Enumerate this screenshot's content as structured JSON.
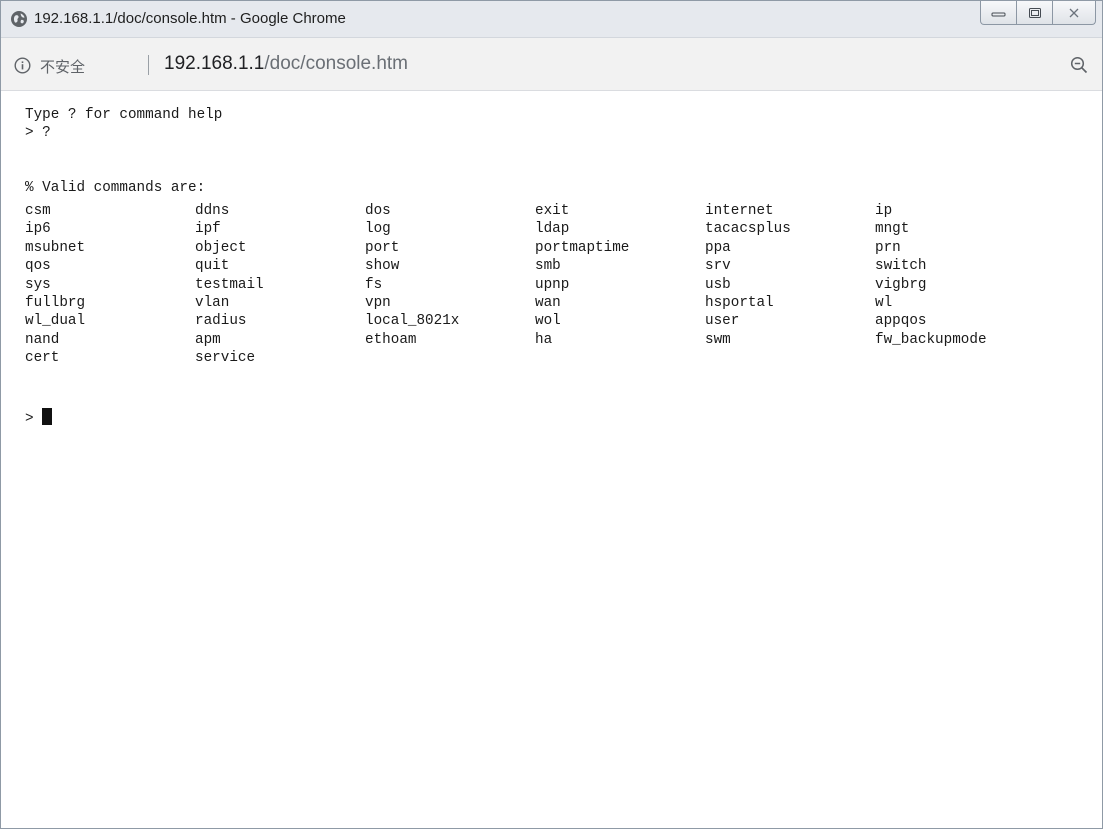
{
  "window": {
    "title": "192.168.1.1/doc/console.htm - Google Chrome",
    "title_icon": "globe-icon",
    "buttons": {
      "minimize_icon": "minimize-icon",
      "maximize_icon": "maximize-icon",
      "close_icon": "close-icon"
    }
  },
  "addressbar": {
    "security_icon": "info-icon",
    "security_label": "不安全",
    "url_host": "192.168.1.1",
    "url_path": "/doc/console.htm",
    "zoom_icon": "zoom-out-icon"
  },
  "console": {
    "help_line": "Type ? for command help",
    "prompt_line": "> ?",
    "valid_header": "% Valid commands are:",
    "commands": [
      "csm",
      "ddns",
      "dos",
      "exit",
      "internet",
      "ip",
      "ip6",
      "ipf",
      "log",
      "ldap",
      "tacacsplus",
      "mngt",
      "msubnet",
      "object",
      "port",
      "portmaptime",
      "ppa",
      "prn",
      "qos",
      "quit",
      "show",
      "smb",
      "srv",
      "switch",
      "sys",
      "testmail",
      "fs",
      "upnp",
      "usb",
      "vigbrg",
      "fullbrg",
      "vlan",
      "vpn",
      "wan",
      "hsportal",
      "wl",
      "wl_dual",
      "radius",
      "local_8021x",
      "wol",
      "user",
      "appqos",
      "nand",
      "apm",
      "ethoam",
      "ha",
      "swm",
      "fw_backupmode",
      "cert",
      "service"
    ],
    "input_prompt": "> ",
    "input_value": ""
  }
}
